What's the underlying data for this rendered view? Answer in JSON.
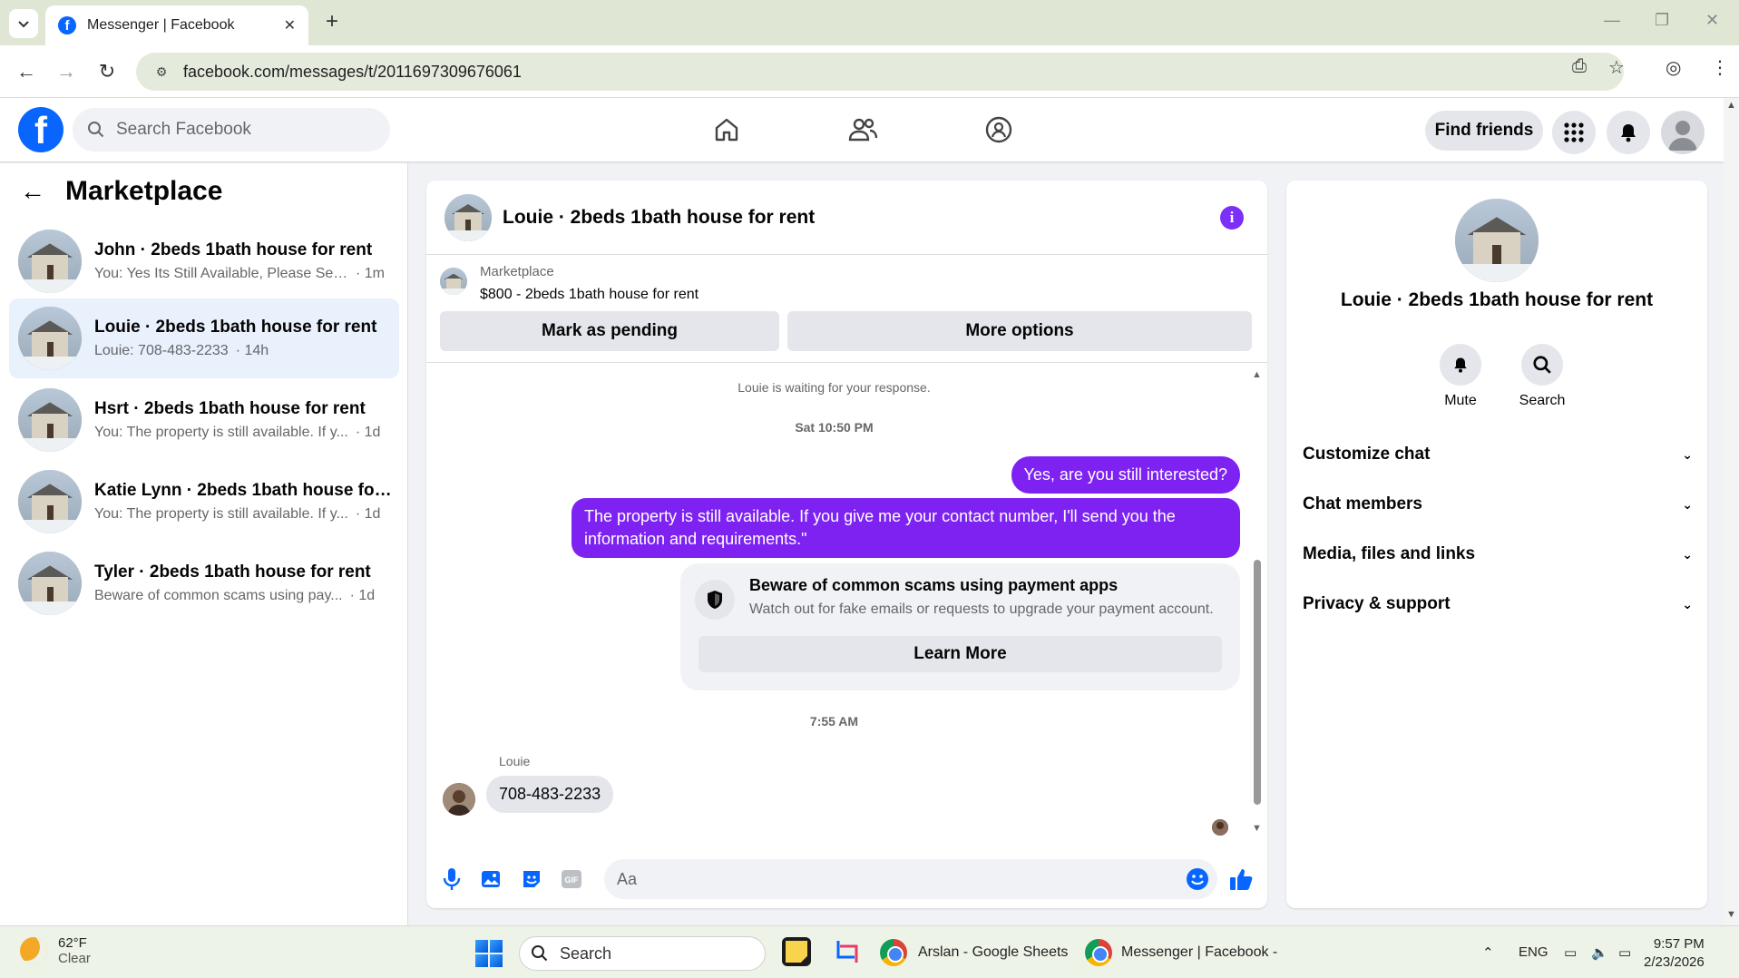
{
  "browser": {
    "tab_title": "Messenger | Facebook",
    "url": "facebook.com/messages/t/2011697309676061"
  },
  "fb": {
    "search_placeholder": "Search Facebook",
    "find_friends": "Find friends"
  },
  "sidebar": {
    "title": "Marketplace",
    "conversations": [
      {
        "name": "John · 2beds 1bath house for rent",
        "preview": "You: Yes Its Still Available, Please Sen...",
        "time": "· 1m",
        "active": false
      },
      {
        "name": "Louie · 2beds 1bath house for rent",
        "preview": "Louie: 708-483-2233",
        "time": "· 14h",
        "active": true
      },
      {
        "name": "Hsrt · 2beds 1bath house for rent",
        "preview": "You: The property is still available. If y...",
        "time": "· 1d",
        "active": false
      },
      {
        "name": "Katie Lynn · 2beds 1bath house for...",
        "preview": "You: The property is still available. If y...",
        "time": "· 1d",
        "active": false
      },
      {
        "name": "Tyler · 2beds 1bath house for rent",
        "preview": "Beware of common scams using pay...",
        "time": "· 1d",
        "active": false
      }
    ]
  },
  "chat": {
    "title": "Louie · 2beds 1bath house for rent",
    "listing_source": "Marketplace",
    "listing_title": "$800 - 2beds 1bath house for rent",
    "mark_pending": "Mark as pending",
    "more_options": "More options",
    "waiting": "Louie is waiting for your response.",
    "time1": "Sat 10:50 PM",
    "msg1": "Yes, are you still interested?",
    "msg2": "The property is still available. If you give me your contact number, I'll send you the information and requirements.\"",
    "scam_title": "Beware of common scams using payment apps",
    "scam_desc": "Watch out for fake emails or requests to upgrade your payment account.",
    "learn_more": "Learn More",
    "time2": "7:55 AM",
    "sender": "Louie",
    "reply": "708-483-2233",
    "composer_placeholder": "Aa"
  },
  "details": {
    "name": "Louie · 2beds 1bath house for rent",
    "mute": "Mute",
    "search": "Search",
    "sections": [
      "Customize chat",
      "Chat members",
      "Media, files and links",
      "Privacy & support"
    ]
  },
  "taskbar": {
    "temp": "62°F",
    "condition": "Clear",
    "search": "Search",
    "app1": "Arslan - Google Sheets",
    "app2": "Messenger | Facebook -",
    "lang": "ENG",
    "time": "9:57 PM",
    "date": "2/23/2026"
  },
  "colors": {
    "accent": "#7e22f2",
    "fb_blue": "#0866ff",
    "active_row": "#e8f1fc"
  }
}
